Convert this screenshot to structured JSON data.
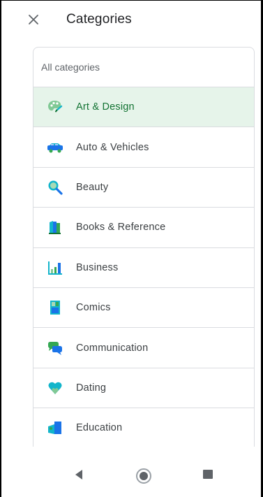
{
  "header": {
    "title": "Categories",
    "close_icon": "close-icon"
  },
  "list": {
    "all_label": "All categories",
    "selected_index": 0,
    "items": [
      {
        "label": "Art & Design",
        "icon": "palette-icon"
      },
      {
        "label": "Auto & Vehicles",
        "icon": "car-icon"
      },
      {
        "label": "Beauty",
        "icon": "mirror-icon"
      },
      {
        "label": "Books & Reference",
        "icon": "books-icon"
      },
      {
        "label": "Business",
        "icon": "bar-chart-icon"
      },
      {
        "label": "Comics",
        "icon": "comic-icon"
      },
      {
        "label": "Communication",
        "icon": "chat-bubbles-icon"
      },
      {
        "label": "Dating",
        "icon": "hearts-icon"
      },
      {
        "label": "Education",
        "icon": "education-icon"
      }
    ]
  },
  "navbar": {
    "back_icon": "back-triangle-icon",
    "home_icon": "home-circle-icon",
    "recent_icon": "recents-square-icon"
  },
  "colors": {
    "selected_bg": "#e6f4ea",
    "selected_text": "#137333",
    "divider": "#dadce0",
    "icon_teal": "#12b5cb",
    "icon_green": "#34a853",
    "icon_blue": "#1a73e8"
  }
}
